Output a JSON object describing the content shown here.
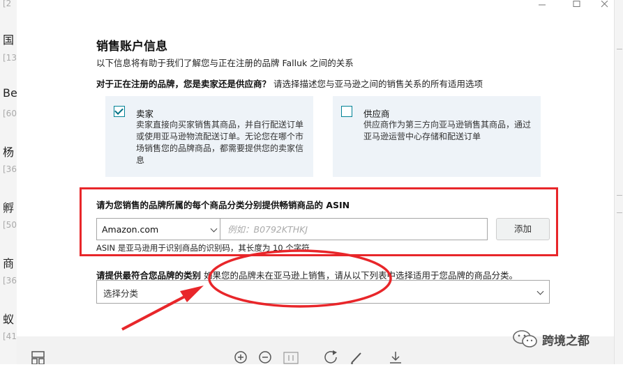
{
  "left_fragments": [
    {
      "text": "[2"
    },
    {
      "text": "国"
    },
    {
      "text": "[13"
    },
    {
      "text": "Be"
    },
    {
      "text": "[60"
    },
    {
      "text": "杨"
    },
    {
      "text": "[36"
    },
    {
      "text": "孵"
    },
    {
      "text": "[50"
    },
    {
      "text": "商"
    },
    {
      "text": "[36"
    },
    {
      "text": "蚁"
    },
    {
      "text": "[41"
    }
  ],
  "section": {
    "title": "销售账户信息",
    "subtitle": "以下信息将有助于我们了解您与正在注册的品牌 Falluk 之间的关系"
  },
  "question": {
    "bold": "对于正在注册的品牌，您是卖家还是供应商？",
    "hint": "请选择描述您与亚马逊之间的销售关系的所有适用选项"
  },
  "options": [
    {
      "label": "卖家",
      "checked": true,
      "desc": "卖家直接向买家销售其商品，并自行配送订单或使用亚马逊物流配送订单。无论您在哪个市场销售您的品牌商品，都需要提供您的卖家信息"
    },
    {
      "label": "供应商",
      "checked": false,
      "desc": "供应商作为第三方向亚马逊销售其商品，通过亚马逊运营中心存储和配送订单"
    }
  ],
  "asin": {
    "title": "请为您销售的品牌所属的每个商品分类分别提供畅销商品的 ASIN",
    "marketplace": "Amazon.com",
    "placeholder": "例如：B0792KTHKJ",
    "add_label": "添加",
    "hint": "ASIN 是亚马逊用于识别商品的识别码，其长度为 10 个字符"
  },
  "category": {
    "label_bold": "请提供最符合您品牌的类别",
    "label_hint": "如果您的品牌未在亚马逊上销售，请从以下列表中选择适用于您品牌的商品分类。",
    "placeholder": "选择分类"
  },
  "watermark": {
    "text": "跨境之都"
  },
  "colors": {
    "accent": "#007185",
    "annotation_red": "#e8262a",
    "card_bg": "#eef3f8"
  }
}
